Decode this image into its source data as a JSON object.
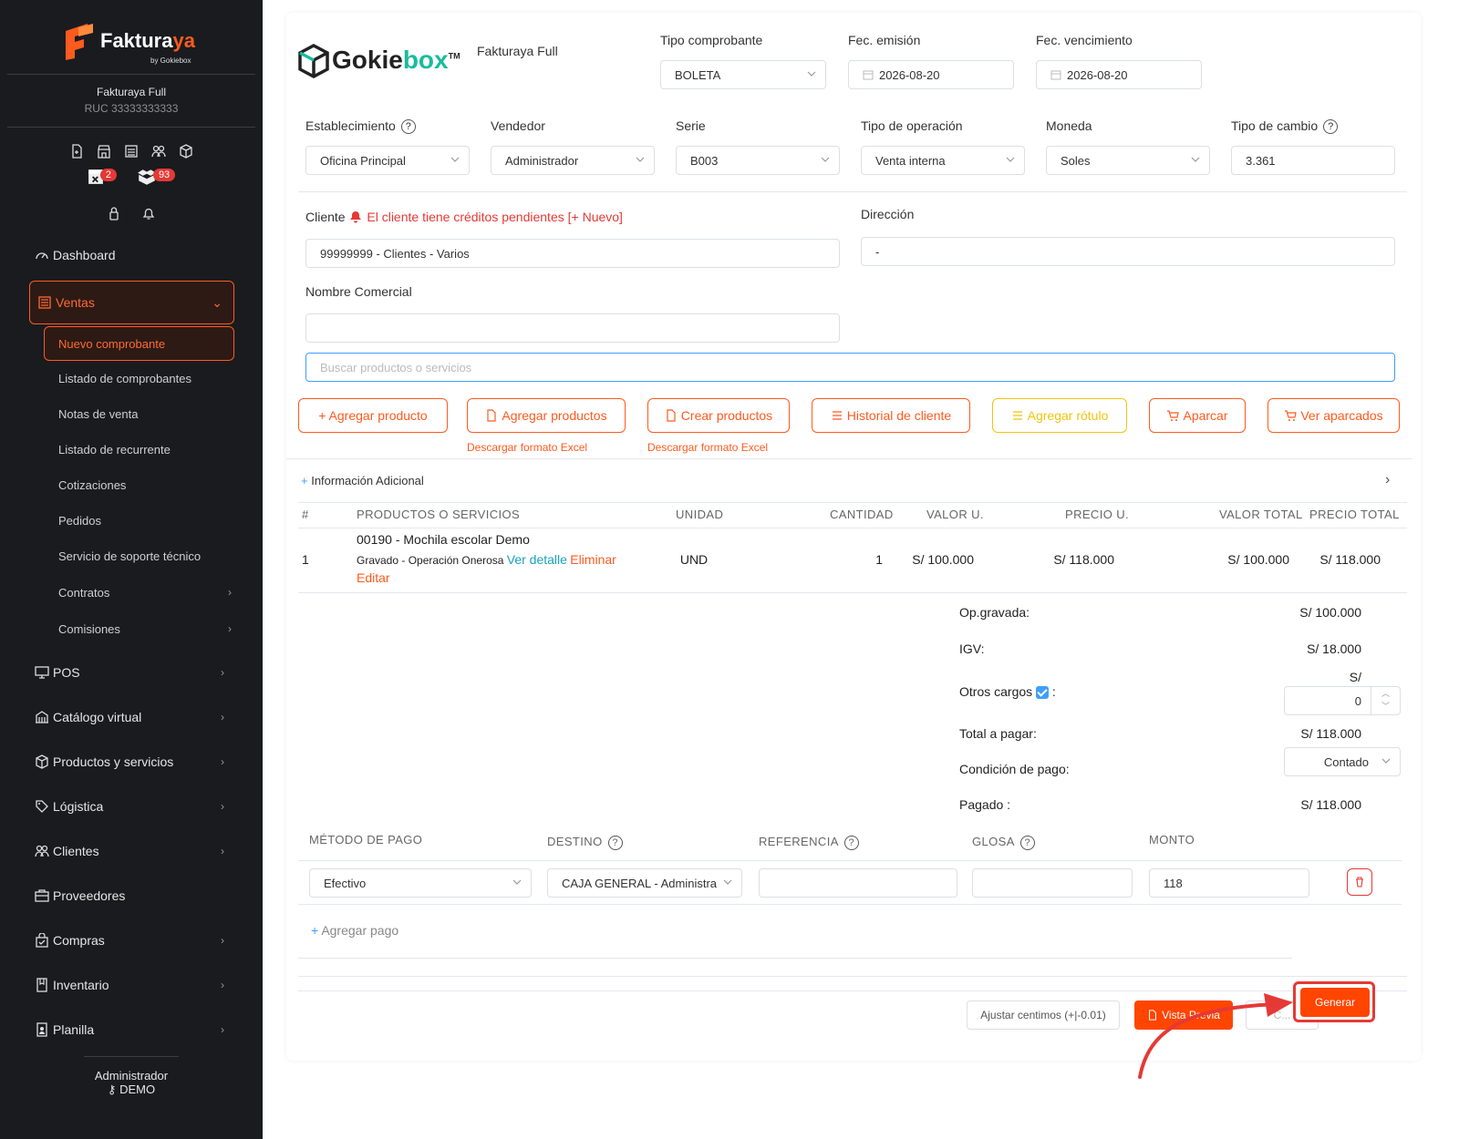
{
  "sidebar": {
    "logo_main": "Faktura",
    "logo_accent": "ya",
    "logo_by": "by Gokiebox",
    "company_name": "Fakturaya Full",
    "ruc": "RUC 33333333333",
    "badge_expired": "2",
    "badge_stock": "93",
    "menu": {
      "dashboard": "Dashboard",
      "ventas": "Ventas",
      "pos": "POS",
      "catalogo": "Catálogo virtual",
      "productos": "Productos y servicios",
      "logistica": "Lógistica",
      "clientes": "Clientes",
      "proveedores": "Proveedores",
      "compras": "Compras",
      "inventario": "Inventario",
      "planilla": "Planilla"
    },
    "ventas_sub": {
      "nuevo": "Nuevo comprobante",
      "listado": "Listado de comprobantes",
      "notas": "Notas de venta",
      "recurrente": "Listado de recurrente",
      "cotizaciones": "Cotizaciones",
      "pedidos": "Pedidos",
      "soporte": "Servicio de soporte técnico",
      "contratos": "Contratos",
      "comisiones": "Comisiones"
    },
    "user_name": "Administrador",
    "user_role": "DEMO"
  },
  "header": {
    "brand_a": "Gokie",
    "brand_b": "box",
    "brand_tm": "TM",
    "plan": "Fakturaya Full",
    "tipo_comprobante_label": "Tipo comprobante",
    "tipo_comprobante_value": "BOLETA",
    "fec_emision_label": "Fec. emisión",
    "fec_emision_value": "2026-08-20",
    "fec_venc_label": "Fec. vencimiento",
    "fec_venc_value": "2026-08-20"
  },
  "row2": {
    "establecimiento_label": "Establecimiento",
    "establecimiento_value": "Oficina Principal",
    "vendedor_label": "Vendedor",
    "vendedor_value": "Administrador",
    "serie_label": "Serie",
    "serie_value": "B003",
    "operacion_label": "Tipo de operación",
    "operacion_value": "Venta interna",
    "moneda_label": "Moneda",
    "moneda_value": "Soles",
    "cambio_label": "Tipo de cambio",
    "cambio_value": "3.361"
  },
  "client": {
    "label": "Cliente",
    "warning": "El cliente tiene créditos pendientes",
    "new_link": "[+ Nuevo]",
    "value": "99999999 - Clientes - Varios",
    "direccion_label": "Dirección",
    "direccion_value": "-",
    "nombre_comercial_label": "Nombre Comercial",
    "nombre_comercial_value": ""
  },
  "search": {
    "placeholder": "Buscar productos o servicios"
  },
  "actions": {
    "agregar_producto": "+ Agregar producto",
    "agregar_productos": "Agregar productos",
    "crear_productos": "Crear productos",
    "historial": "Historial de cliente",
    "rotulo": "Agregar rótulo",
    "aparcar": "Aparcar",
    "ver_aparcados": "Ver aparcados",
    "excel1": "Descargar formato Excel",
    "excel2": "Descargar formato Excel"
  },
  "info_adicional": "Información Adicional",
  "table": {
    "headers": [
      "#",
      "PRODUCTOS O SERVICIOS",
      "UNIDAD",
      "CANTIDAD",
      "VALOR U.",
      "PRECIO U.",
      "VALOR TOTAL",
      "PRECIO TOTAL"
    ],
    "rows": [
      {
        "num": "1",
        "product": "00190 - Mochila escolar Demo",
        "sub": "Gravado - Operación Onerosa",
        "ver": "Ver detalle",
        "eliminar": "Eliminar",
        "editar": "Editar",
        "unidad": "UND",
        "cantidad": "1",
        "valor_u": "S/ 100.000",
        "precio_u": "S/ 118.000",
        "valor_total": "S/ 100.000",
        "precio_total": "S/ 118.000"
      }
    ]
  },
  "totals": {
    "op_gravada_label": "Op.gravada:",
    "op_gravada_value": "S/ 100.000",
    "igv_label": "IGV:",
    "igv_value": "S/ 18.000",
    "otros_label": "Otros cargos",
    "otros_colon": ":",
    "otros_currency": "S/",
    "otros_value": "0",
    "total_label": "Total a pagar:",
    "total_value": "S/ 118.000",
    "condicion_label": "Condición de pago:",
    "condicion_value": "Contado",
    "pagado_label": "Pagado :",
    "pagado_value": "S/ 118.000"
  },
  "payments": {
    "headers": {
      "metodo": "MÉTODO DE PAGO",
      "destino": "DESTINO",
      "referencia": "REFERENCIA",
      "glosa": "GLOSA",
      "monto": "MONTO"
    },
    "row": {
      "metodo": "Efectivo",
      "destino": "CAJA GENERAL - Administra",
      "referencia": "",
      "glosa": "",
      "monto": "118"
    },
    "add": "Agregar pago"
  },
  "footer": {
    "ajustar": "Ajustar centimos (+|-0.01)",
    "vista": "Vista Previa",
    "cancel": "C...",
    "generar": "Generar"
  },
  "colors": {
    "accent": "#ff5a1f",
    "sidebar": "#191b1f",
    "annotation": "#e53935"
  }
}
